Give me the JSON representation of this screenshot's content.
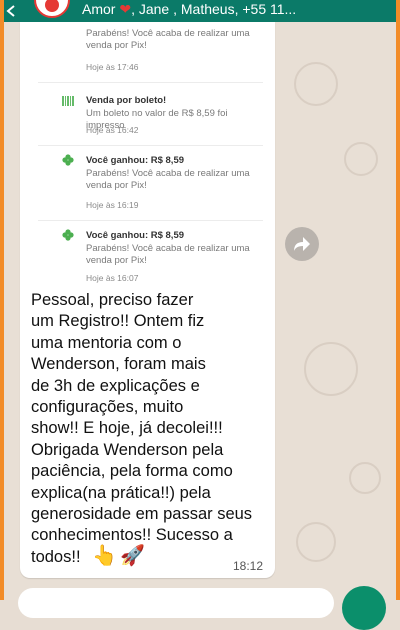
{
  "header": {
    "title_prefix": "Amor ",
    "title_suffix": ", Jane , Matheus, +55 11...",
    "heart": "❤"
  },
  "notifications": [
    {
      "title": "",
      "body": "Parabéns! Você acaba de realizar uma venda por Pix!",
      "time": "Hoje às 17:46",
      "icon": "clover-icon"
    },
    {
      "title": "Venda por boleto!",
      "body": "Um boleto no valor de R$ 8,59 foi impresso",
      "time": "Hoje às 16:42",
      "icon": "barcode-icon"
    },
    {
      "title": "Você ganhou: R$ 8,59",
      "body": "Parabéns! Você acaba de realizar uma venda por Pix!",
      "time": "Hoje às 16:19",
      "icon": "clover-icon"
    },
    {
      "title": "Você ganhou: R$ 8,59",
      "body": "Parabéns! Você acaba de realizar uma venda por Pix!",
      "time": "Hoje às 16:07",
      "icon": "clover-icon"
    }
  ],
  "message": {
    "text": "Pessoal, preciso fazer\num Registro!! Ontem fiz\numa mentoria com o\nWenderson, foram mais\nde 3h de explicações e\nconfigurações, muito\nshow!! E hoje, já decolei!!!\nObrigada Wenderson pela\npaciência, pela forma como\nexplica(na prática!!) pela\ngenerosidade em passar seus\nconhecimentos!! Sucesso a\ntodos!!",
    "time": "18:12",
    "emoji_1": "👆",
    "emoji_2": "🚀"
  },
  "colors": {
    "header_bg": "#0b7a68",
    "accent_green": "#4caf50",
    "frame_orange": "#f28c28"
  }
}
